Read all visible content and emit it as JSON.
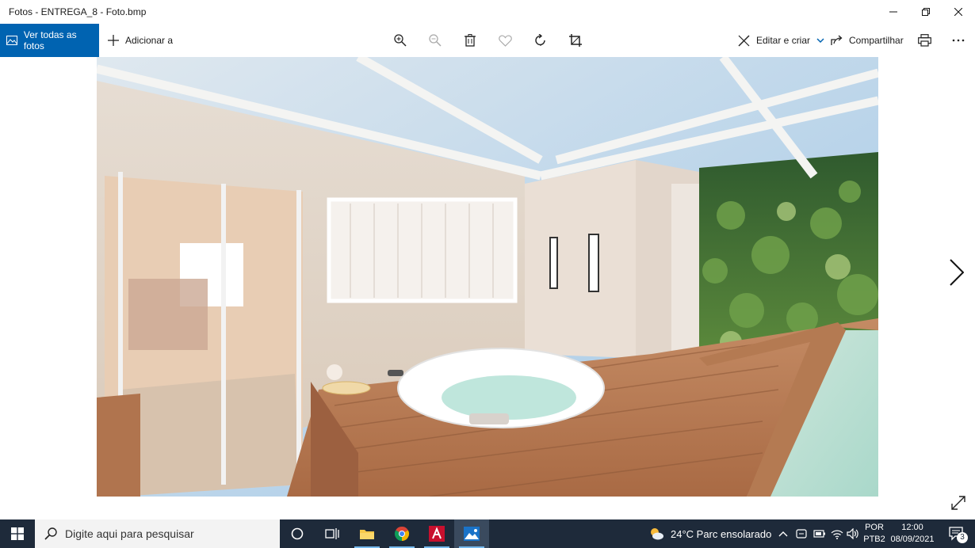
{
  "window": {
    "title": "Fotos - ENTREGA_8 - Foto.bmp"
  },
  "toolbar": {
    "all_photos_label": "Ver todas as fotos",
    "add_to_label": "Adicionar a",
    "edit_create_label": "Editar e criar",
    "share_label": "Compartilhar",
    "icons": [
      "zoom-in-icon",
      "zoom-out-icon",
      "delete-icon",
      "favorite-icon",
      "rotate-icon",
      "crop-icon",
      "print-icon",
      "more-icon"
    ]
  },
  "photo": {
    "description_icon": "photo-image"
  },
  "taskbar": {
    "search_placeholder": "Digite aqui para pesquisar",
    "weather_text": "24°C  Parc ensolarado",
    "lang_line1": "POR",
    "lang_line2": "PTB2",
    "time": "12:00",
    "date": "08/09/2021",
    "notification_count": "3",
    "apps": [
      "cortana-icon",
      "task-view-icon",
      "file-explorer-icon",
      "chrome-icon",
      "autocad-icon",
      "photos-icon"
    ]
  },
  "colors": {
    "accent": "#0063b1",
    "taskbar": "#1e2a3a"
  }
}
